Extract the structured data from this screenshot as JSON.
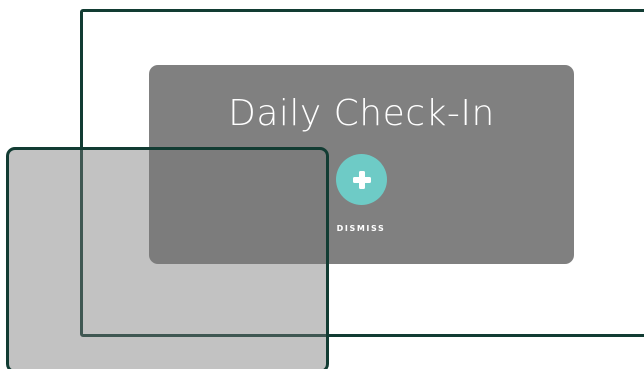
{
  "card": {
    "title": "Daily Check-In",
    "dismiss_label": "DISMISS"
  },
  "icons": {
    "plus": "plus-icon"
  },
  "colors": {
    "frame_border": "#123c33",
    "card_bg": "#808080",
    "plus_button_bg": "#6ecbc6",
    "text": "#ffffff"
  }
}
